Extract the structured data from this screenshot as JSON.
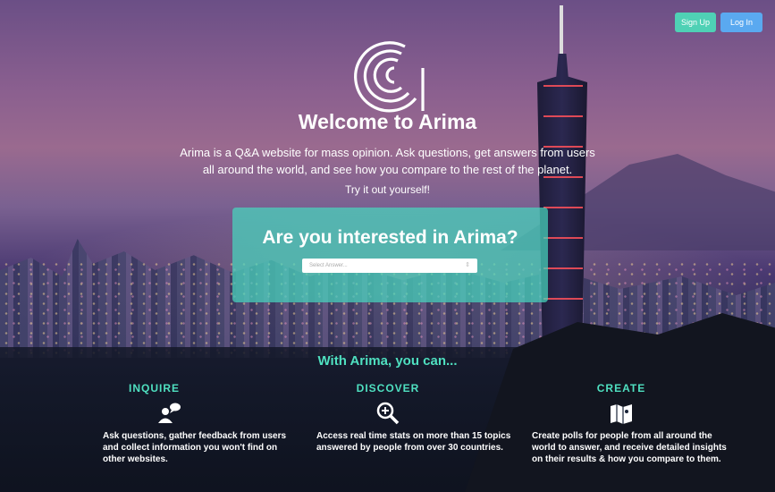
{
  "header": {
    "signup_label": "Sign Up",
    "login_label": "Log In"
  },
  "hero": {
    "title": "Welcome to Arima",
    "subtitle": "Arima is a Q&A website for mass opinion. Ask questions, get answers from users all around the world, and see how you compare to the rest of the planet.",
    "cta": "Try it out yourself!"
  },
  "poll": {
    "question": "Are you interested in Arima?",
    "select_placeholder": "Select Answer..."
  },
  "features": {
    "heading": "With Arima, you can...",
    "items": [
      {
        "title": "INQUIRE",
        "icon": "chat-user-icon",
        "text": "Ask questions, gather feedback from users and collect information you won't find on other websites."
      },
      {
        "title": "DISCOVER",
        "icon": "magnify-plus-icon",
        "text": "Access real time stats on more than 15 topics answered by people from over 30 countries."
      },
      {
        "title": "CREATE",
        "icon": "map-icon",
        "text": "Create polls for people from all around the world to answer, and receive detailed insights on their results & how you compare to them."
      }
    ]
  },
  "colors": {
    "accent": "#4fe0c0",
    "signup": "#4fd1b5",
    "login": "#5aa9f0"
  }
}
